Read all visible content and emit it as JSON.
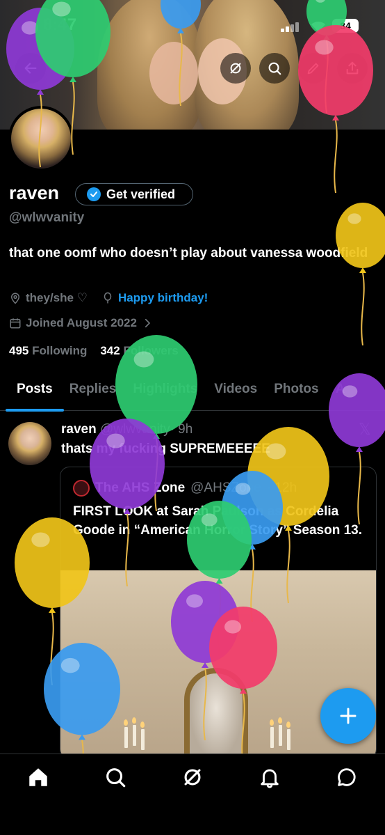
{
  "status_bar": {
    "time": "8:47",
    "battery": "84"
  },
  "profile": {
    "name": "raven",
    "verify_label": "Get verified",
    "handle": "@wlwvanity",
    "bio": "that one oomf who doesn’t play about vanessa woodfield",
    "pronouns": "they/she ♡",
    "birthday": "Happy birthday!",
    "joined": "Joined August 2022",
    "following_count": "495",
    "following_label": "Following",
    "followers_count": "342",
    "followers_label": "Followers"
  },
  "tabs": [
    {
      "label": "Posts"
    },
    {
      "label": "Replies"
    },
    {
      "label": "Highlights"
    },
    {
      "label": "Videos"
    },
    {
      "label": "Photos"
    },
    {
      "label": "A"
    }
  ],
  "post": {
    "author": "raven",
    "handle": "@wlwvanity",
    "time": "· 9h",
    "text": "thats my fucking SUPREMEEEEE",
    "quote": {
      "author": "The AHS Zone",
      "handle": "@AHSZone",
      "time": "· 12h",
      "text": "FIRST LOOK at Sarah Paulson as Cordelia Goode in “American Horror Story” Season 13."
    }
  },
  "icons": {
    "back": "arrow-left-icon",
    "grok": "grok-icon",
    "search": "search-icon",
    "edit": "pencil-icon",
    "share": "share-icon",
    "compose": "plus-icon",
    "nav": [
      "home-icon",
      "search-icon",
      "grok-icon",
      "bell-icon",
      "chat-icon"
    ]
  },
  "colors": {
    "accent": "#1d9bf0",
    "background": "#000000",
    "muted": "#71767b"
  }
}
